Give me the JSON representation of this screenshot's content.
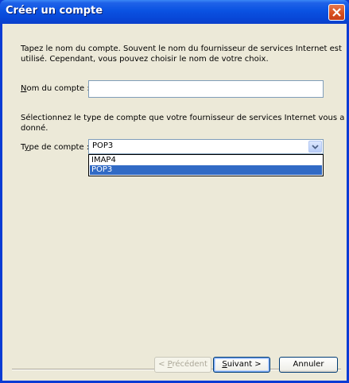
{
  "window": {
    "title": "Créer un compte"
  },
  "intro_text": {
    "line1": "Tapez le nom du compte. Souvent le nom du fournisseur de services Internet est",
    "line2": "utilisé. Cependant, vous pouvez choisir le nom de votre choix."
  },
  "account_name": {
    "label_mnemonic": "N",
    "label_rest": "om du compte :",
    "value": ""
  },
  "type_text": {
    "line1": "Sélectionnez le type de compte que votre fournisseur de services Internet vous a",
    "line2": "donné."
  },
  "account_type": {
    "label_pre": "T",
    "label_mnemonic": "y",
    "label_rest": "pe de compte :",
    "selected": "POP3",
    "options": [
      "IMAP4",
      "POP3"
    ]
  },
  "buttons": {
    "back_arrow": "< ",
    "back_mnemonic": "P",
    "back_rest": "récédent",
    "next_mnemonic": "S",
    "next_rest": "uivant >",
    "cancel": "Annuler"
  },
  "colors": {
    "title_bar": "#0a52e2",
    "selection": "#316ac5",
    "dialog_bg": "#ece9d8"
  }
}
